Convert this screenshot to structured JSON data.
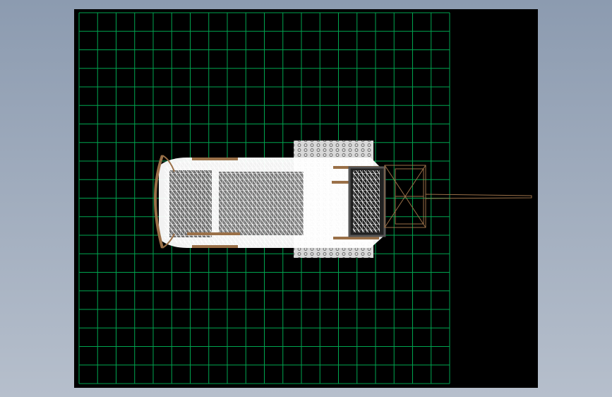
{
  "viewport": {
    "background_color": "#000000",
    "grid": {
      "visible": true,
      "columns": 20,
      "rows": 20,
      "line_color": "#00a550",
      "minor_line_color": "#808080"
    },
    "model": {
      "display_mode": "wireframe",
      "mesh_color": "#ffffff",
      "part_color": "#9a7048",
      "shaded_part_color": "#d0d0d0",
      "dark_part_color": "#505050"
    }
  }
}
